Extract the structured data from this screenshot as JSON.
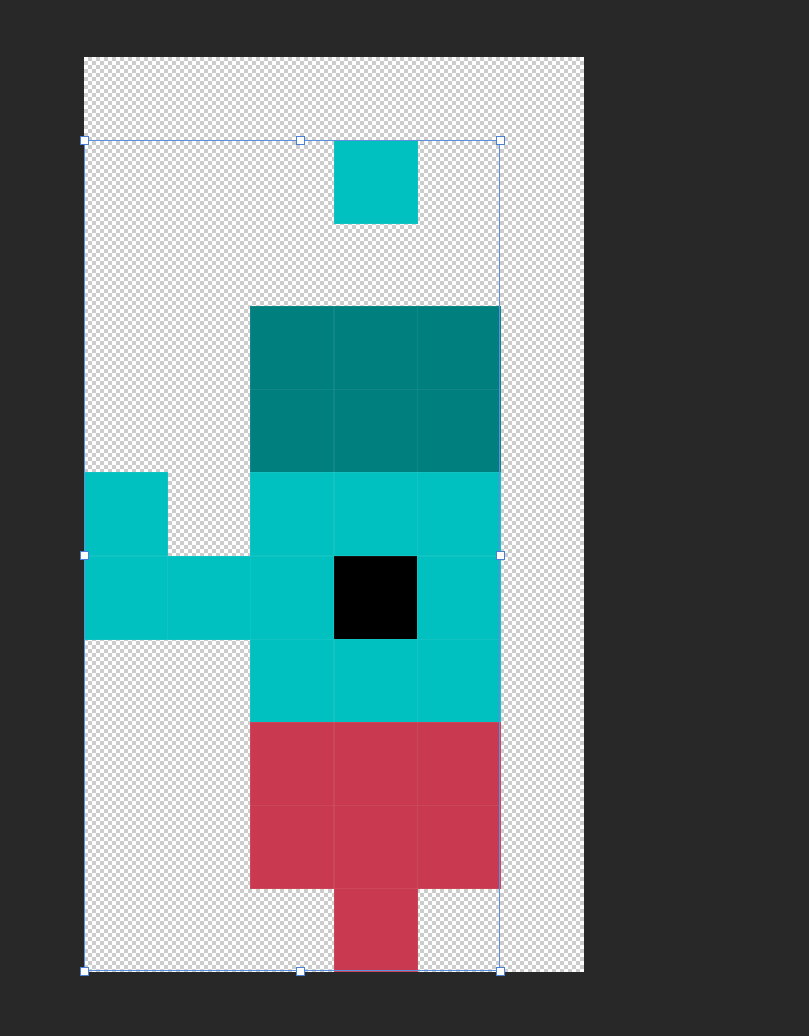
{
  "editor": {
    "canvas_background": "transparent-checkerboard",
    "workspace_color": "#282828",
    "selection_color": "#5b8fe0"
  },
  "pixel_art": {
    "grid_columns": 5,
    "grid_rows": 10,
    "palette": {
      "cyan": "#00c0c0",
      "dark_teal": "#007f7f",
      "black": "#000000",
      "red": "#c93a50"
    },
    "cells": [
      {
        "col": 3,
        "row": 0,
        "color": "cyan"
      },
      {
        "col": 2,
        "row": 2,
        "color": "dark_teal"
      },
      {
        "col": 3,
        "row": 2,
        "color": "dark_teal"
      },
      {
        "col": 4,
        "row": 2,
        "color": "dark_teal"
      },
      {
        "col": 2,
        "row": 3,
        "color": "dark_teal"
      },
      {
        "col": 3,
        "row": 3,
        "color": "dark_teal"
      },
      {
        "col": 4,
        "row": 3,
        "color": "dark_teal"
      },
      {
        "col": 0,
        "row": 4,
        "color": "cyan"
      },
      {
        "col": 2,
        "row": 4,
        "color": "cyan"
      },
      {
        "col": 3,
        "row": 4,
        "color": "cyan"
      },
      {
        "col": 4,
        "row": 4,
        "color": "cyan"
      },
      {
        "col": 0,
        "row": 5,
        "color": "cyan"
      },
      {
        "col": 1,
        "row": 5,
        "color": "cyan"
      },
      {
        "col": 2,
        "row": 5,
        "color": "cyan"
      },
      {
        "col": 3,
        "row": 5,
        "color": "black"
      },
      {
        "col": 4,
        "row": 5,
        "color": "cyan"
      },
      {
        "col": 2,
        "row": 6,
        "color": "cyan"
      },
      {
        "col": 3,
        "row": 6,
        "color": "cyan"
      },
      {
        "col": 4,
        "row": 6,
        "color": "cyan"
      },
      {
        "col": 2,
        "row": 7,
        "color": "red"
      },
      {
        "col": 3,
        "row": 7,
        "color": "red"
      },
      {
        "col": 4,
        "row": 7,
        "color": "red"
      },
      {
        "col": 2,
        "row": 8,
        "color": "red"
      },
      {
        "col": 3,
        "row": 8,
        "color": "red"
      },
      {
        "col": 4,
        "row": 8,
        "color": "red"
      },
      {
        "col": 3,
        "row": 9,
        "color": "red"
      }
    ]
  },
  "selection": {
    "handles": [
      "top-left",
      "top-center",
      "top-right",
      "middle-left",
      "middle-right",
      "bottom-left",
      "bottom-center",
      "bottom-right"
    ]
  }
}
